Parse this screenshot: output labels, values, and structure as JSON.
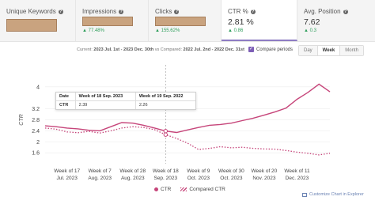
{
  "metrics": [
    {
      "title": "Unique Keywords",
      "value": "",
      "delta": ""
    },
    {
      "title": "Impressions",
      "value": "",
      "delta": "77.48%"
    },
    {
      "title": "Clicks",
      "value": "",
      "delta": "155.62%"
    },
    {
      "title": "CTR %",
      "value": "2.81 %",
      "delta": "0.86"
    },
    {
      "title": "Avg. Position",
      "value": "7.62",
      "delta": "0.3"
    }
  ],
  "period": {
    "current_label": "Current:",
    "current_range": "2023 Jul. 1st - 2023 Dec. 30th",
    "vs_label": "vs Compared:",
    "compared_range": "2022 Jul. 2nd - 2022 Dec. 31st"
  },
  "compare_toggle": {
    "label": "Compare periods",
    "checked": true
  },
  "granularity": {
    "options": [
      "Day",
      "Week",
      "Month"
    ],
    "selected": "Week"
  },
  "tooltip": {
    "col_date": "Date",
    "col_current": "Week of 18 Sep. 2023",
    "col_compared": "Week of 19 Sep. 2022",
    "row_label": "CTR",
    "current_value": "2.39",
    "compared_value": "2.26"
  },
  "legend": {
    "ctr": "CTR",
    "compared": "Compared CTR"
  },
  "customize_link": "Customize Chart in Explorer",
  "chart_data": {
    "type": "line",
    "ylabel": "CTR",
    "yticks": [
      1.6,
      2,
      2.4,
      2.8,
      3.2,
      4
    ],
    "ylim": [
      1.2,
      4.4
    ],
    "xticks": [
      {
        "line1": "Week of 17",
        "line2": "Jul. 2023",
        "idx": 2
      },
      {
        "line1": "Week of 7",
        "line2": "Aug. 2023",
        "idx": 5
      },
      {
        "line1": "Week of 28",
        "line2": "Aug. 2023",
        "idx": 8
      },
      {
        "line1": "Week of 18",
        "line2": "Sep. 2023",
        "idx": 11
      },
      {
        "line1": "Week of 9",
        "line2": "Oct. 2023",
        "idx": 14
      },
      {
        "line1": "Week of 30",
        "line2": "Oct. 2023",
        "idx": 17
      },
      {
        "line1": "Week of 20",
        "line2": "Nov. 2023",
        "idx": 20
      },
      {
        "line1": "Week of 11",
        "line2": "Dec. 2023",
        "idx": 23
      }
    ],
    "highlight_index": 11,
    "series": [
      {
        "name": "CTR",
        "values": [
          2.58,
          2.55,
          2.5,
          2.47,
          2.42,
          2.4,
          2.55,
          2.7,
          2.68,
          2.6,
          2.5,
          2.39,
          2.34,
          2.43,
          2.52,
          2.6,
          2.63,
          2.68,
          2.77,
          2.86,
          2.97,
          3.09,
          3.23,
          3.55,
          3.8,
          4.1,
          3.82
        ]
      },
      {
        "name": "Compared CTR",
        "values": [
          2.5,
          2.46,
          2.36,
          2.33,
          2.38,
          2.32,
          2.4,
          2.5,
          2.55,
          2.52,
          2.44,
          2.26,
          2.12,
          1.95,
          1.72,
          1.76,
          1.82,
          1.78,
          1.8,
          1.76,
          1.74,
          1.73,
          1.68,
          1.62,
          1.58,
          1.52,
          1.58
        ]
      }
    ],
    "colors": {
      "line": "#c6457a",
      "grid": "#e8e8e8"
    }
  }
}
